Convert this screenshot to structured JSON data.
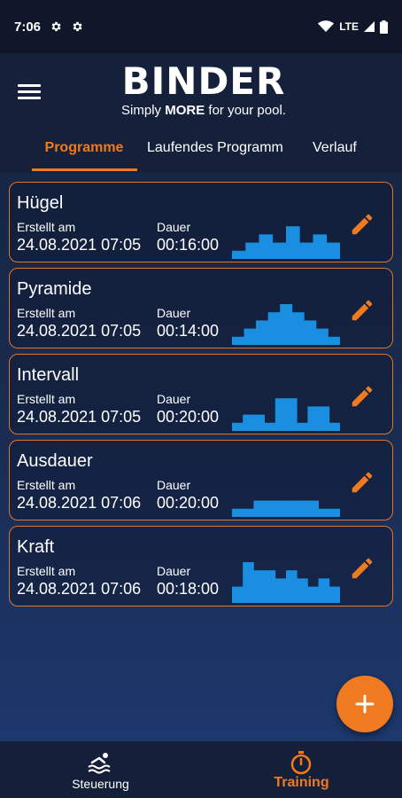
{
  "status_bar": {
    "time": "7:06",
    "network": "LTE"
  },
  "header": {
    "brand": "BINDER",
    "tagline_prefix": "Simply ",
    "tagline_bold": "MORE",
    "tagline_suffix": " for your pool."
  },
  "tabs": [
    {
      "label": "Programme",
      "active": true
    },
    {
      "label": "Laufendes Programm",
      "active": false
    },
    {
      "label": "Verlauf",
      "active": false
    }
  ],
  "labels": {
    "created": "Erstellt am",
    "duration": "Dauer"
  },
  "programs": [
    {
      "name": "Hügel",
      "created": "24.08.2021 07:05",
      "duration": "00:16:00",
      "profile": [
        1,
        2,
        3,
        2,
        4,
        2,
        3,
        2
      ]
    },
    {
      "name": "Pyramide",
      "created": "24.08.2021 07:05",
      "duration": "00:14:00",
      "profile": [
        1,
        2,
        3,
        4,
        5,
        4,
        3,
        2,
        1
      ]
    },
    {
      "name": "Intervall",
      "created": "24.08.2021 07:05",
      "duration": "00:20:00",
      "profile": [
        1,
        2,
        2,
        1,
        4,
        4,
        1,
        3,
        3,
        1
      ]
    },
    {
      "name": "Ausdauer",
      "created": "24.08.2021 07:06",
      "duration": "00:20:00",
      "profile": [
        1,
        1,
        2,
        2,
        2,
        2,
        2,
        2,
        1,
        1
      ]
    },
    {
      "name": "Kraft",
      "created": "24.08.2021 07:06",
      "duration": "00:18:00",
      "profile": [
        2,
        5,
        4,
        4,
        3,
        4,
        3,
        2,
        3,
        2
      ]
    }
  ],
  "bottom_nav": [
    {
      "label": "Steuerung",
      "icon": "swimmer-icon",
      "active": false
    },
    {
      "label": "Training",
      "icon": "stopwatch-icon",
      "active": true
    }
  ],
  "colors": {
    "accent": "#f07a1f",
    "chart_blue": "#1a8ee0",
    "background": "#1a2c52"
  }
}
